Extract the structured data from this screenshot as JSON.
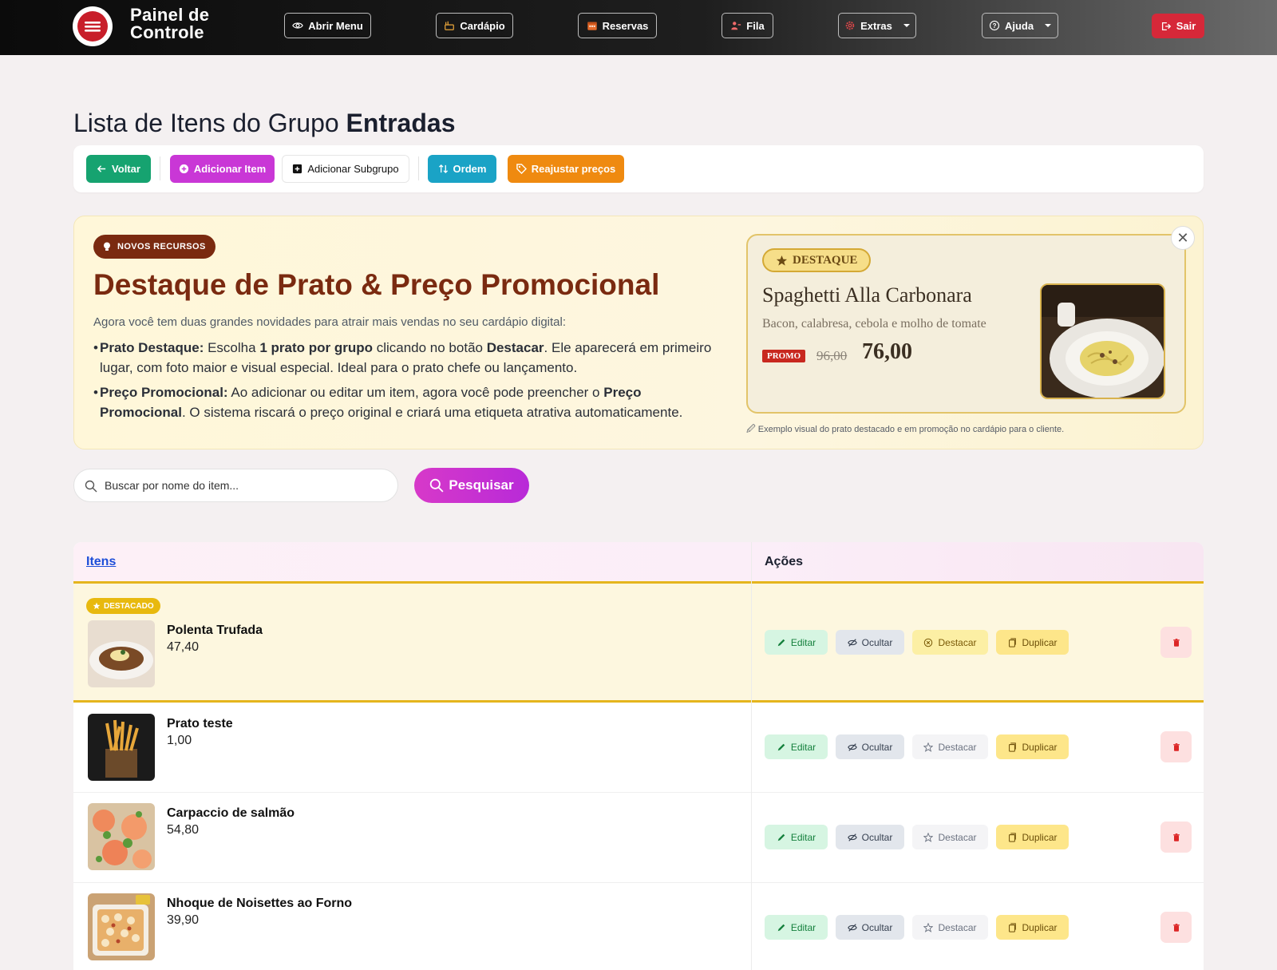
{
  "app": {
    "logo_text_line1": "Painel de",
    "logo_text_line2": "Controle"
  },
  "nav": {
    "abrir_menu": "Abrir Menu",
    "cardapio": "Cardápio",
    "reservas": "Reservas",
    "fila": "Fila",
    "extras": "Extras",
    "ajuda": "Ajuda",
    "sair": "Sair"
  },
  "page": {
    "title_prefix": "Lista de Itens do Grupo ",
    "title_group": "Entradas"
  },
  "toolbar": {
    "voltar": "Voltar",
    "adicionar_item": "Adicionar Item",
    "adicionar_subgrupo": "Adicionar Subgrupo",
    "ordem": "Ordem",
    "reajustar": "Reajustar preços"
  },
  "promo": {
    "badge": "NOVOS RECURSOS",
    "title": "Destaque de Prato & Preço Promocional",
    "intro": "Agora você tem duas grandes novidades para atrair mais vendas no seu cardápio digital:",
    "b1_label": "Prato Destaque:",
    "b1_t1": " Escolha ",
    "b1_bold1": "1 prato por grupo",
    "b1_t2": " clicando no botão ",
    "b1_bold2": "Destacar",
    "b1_t3": ". Ele aparecerá em primeiro lugar, com foto maior e visual especial. Ideal para o prato chefe ou lançamento.",
    "b2_label": "Preço Promocional:",
    "b2_t1": " Ao adicionar ou editar um item, agora você pode preencher o ",
    "b2_bold1": "Preço Promocional",
    "b2_t2": ". O sistema riscará o preço original e criará uma etiqueta atrativa automaticamente.",
    "preview": {
      "tag": "DESTAQUE",
      "name": "Spaghetti Alla Carbonara",
      "desc": "Bacon, calabresa, cebola e molho de tomate",
      "promo_label": "PROMO",
      "old_price": "96,00",
      "new_price": "76,00"
    },
    "caption": "Exemplo visual do prato destacado e em promoção no cardápio para o cliente."
  },
  "search": {
    "placeholder": "Buscar por nome do item...",
    "button": "Pesquisar"
  },
  "table": {
    "col_itens": "Itens",
    "col_acoes": "Ações",
    "featured_badge": "DESTACADO",
    "actions": {
      "edit": "Editar",
      "hide": "Ocultar",
      "highlight": "Destacar",
      "duplicate": "Duplicar"
    },
    "rows": [
      {
        "name": "Polenta Trufada",
        "price": "47,40",
        "featured": true
      },
      {
        "name": "Prato teste",
        "price": "1,00",
        "featured": false
      },
      {
        "name": "Carpaccio de salmão",
        "price": "54,80",
        "featured": false
      },
      {
        "name": "Nhoque de Noisettes ao Forno",
        "price": "39,90",
        "featured": false
      }
    ]
  },
  "colors": {
    "accent_magenta": "#c935d1",
    "brand_red": "#c81e2a",
    "featured_gold": "#e5b51d",
    "promo_brown": "#7a2a10"
  }
}
